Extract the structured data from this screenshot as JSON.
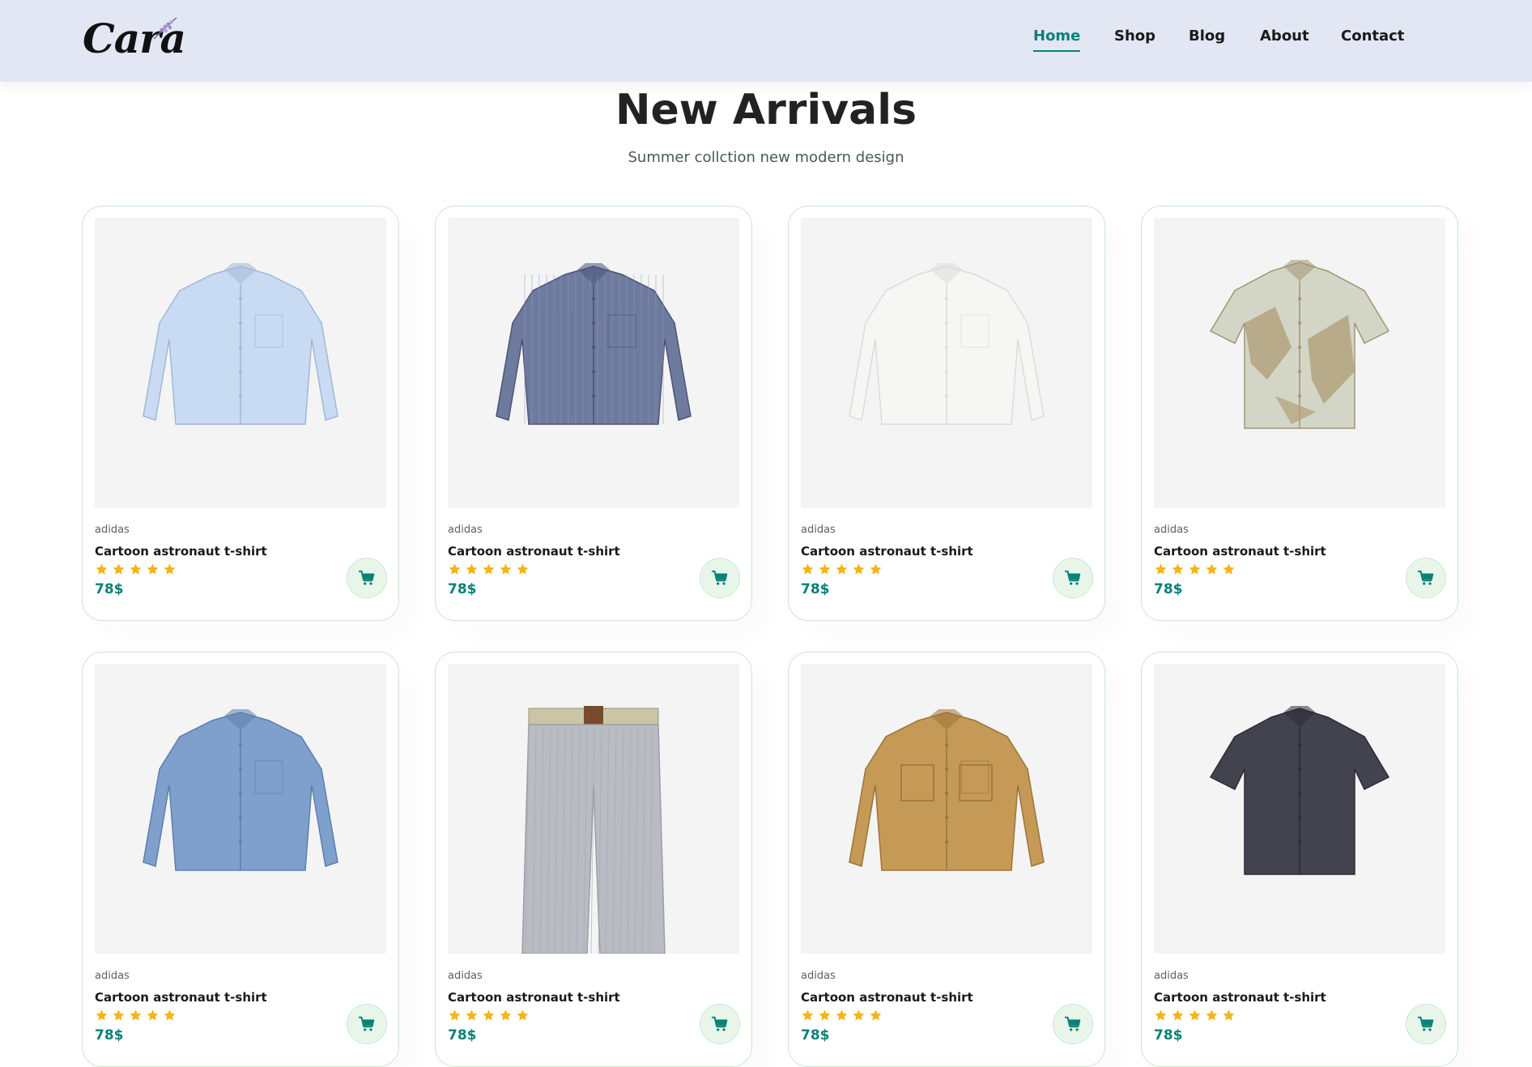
{
  "header": {
    "logo_text": "Cara",
    "nav": [
      {
        "label": "Home",
        "active": true
      },
      {
        "label": "Shop",
        "active": false
      },
      {
        "label": "Blog",
        "active": false
      },
      {
        "label": "About",
        "active": false
      },
      {
        "label": "Contact",
        "active": false
      }
    ]
  },
  "section": {
    "title": "New Arrivals",
    "subtitle": "Summer collction new modern design"
  },
  "products": [
    {
      "brand": "adidas",
      "name": "Cartoon astronaut t-shirt",
      "rating": 5,
      "price": "78$",
      "image": "light-blue-long-sleeve-shirt"
    },
    {
      "brand": "adidas",
      "name": "Cartoon astronaut t-shirt",
      "rating": 5,
      "price": "78$",
      "image": "navy-check-long-sleeve-shirt"
    },
    {
      "brand": "adidas",
      "name": "Cartoon astronaut t-shirt",
      "rating": 5,
      "price": "78$",
      "image": "white-long-sleeve-shirt"
    },
    {
      "brand": "adidas",
      "name": "Cartoon astronaut t-shirt",
      "rating": 5,
      "price": "78$",
      "image": "printed-short-sleeve-shirt"
    },
    {
      "brand": "adidas",
      "name": "Cartoon astronaut t-shirt",
      "rating": 5,
      "price": "78$",
      "image": "denim-long-sleeve-shirt"
    },
    {
      "brand": "adidas",
      "name": "Cartoon astronaut t-shirt",
      "rating": 5,
      "price": "78$",
      "image": "striped-trousers"
    },
    {
      "brand": "adidas",
      "name": "Cartoon astronaut t-shirt",
      "rating": 5,
      "price": "78$",
      "image": "camel-overshirt"
    },
    {
      "brand": "adidas",
      "name": "Cartoon astronaut t-shirt",
      "rating": 5,
      "price": "78$",
      "image": "charcoal-short-sleeve-shirt"
    }
  ],
  "colors": {
    "accent": "#088178",
    "header_bg": "#e3e6f3",
    "star": "#f3b519",
    "cart_bg": "#e8f6ea",
    "card_border": "#cce7d0"
  },
  "icons": {
    "cart": "cart-icon",
    "star": "star-icon"
  }
}
